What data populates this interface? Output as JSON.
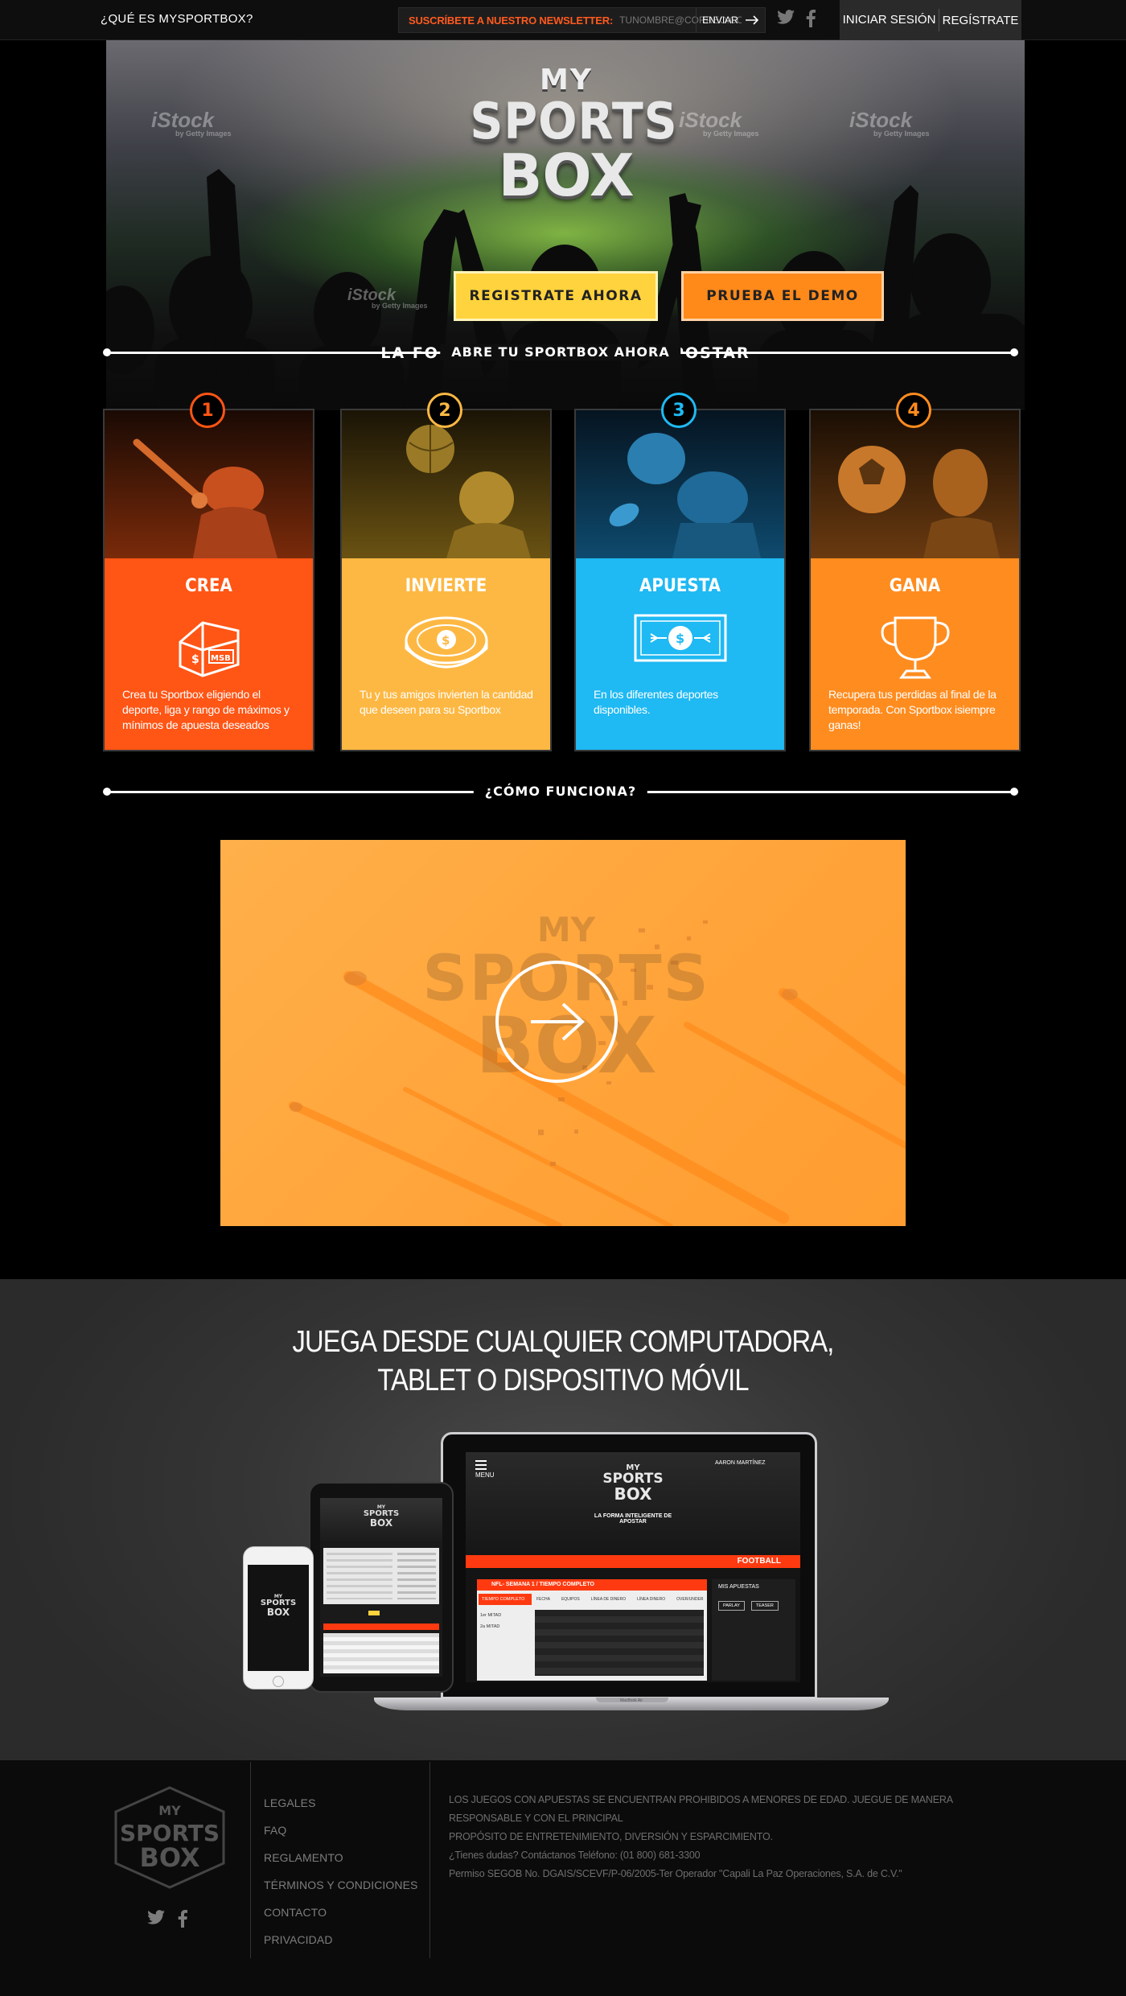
{
  "topbar": {
    "about_link": "¿QUÉ ES MYSPORTBOX?",
    "newsletter_label": "SUSCRÍBETE A NUESTRO NEWSLETTER:",
    "newsletter_placeholder": "TUNOMBRE@CORREO.COM",
    "send_label": "ENVIAR",
    "login_label": "INICIAR SESIÓN",
    "register_label": "REGÍSTRATE",
    "icons": [
      "twitter-icon",
      "facebook-icon",
      "arrow-right-icon"
    ]
  },
  "hero": {
    "logo": {
      "my": "MY",
      "sports": "SPORTS",
      "box": "BOX"
    },
    "watermarks": [
      "iStock",
      "iStock",
      "iStock",
      "iStock"
    ],
    "watermark_sub": "by Getty Images",
    "register_button": "REGISTRATE AHORA",
    "demo_button": "PRUEBA EL DEMO",
    "tagline": "LA FORMA INTELIGENTE DE APOSTAR"
  },
  "section_open": {
    "label": "ABRE TU SPORTBOX AHORA"
  },
  "steps": [
    {
      "number": "1",
      "title": "CREA",
      "description": "Crea tu Sportbox eligiendo el deporte, liga y rango de máximos y mínimos de apuesta deseados",
      "color": "#ff5515"
    },
    {
      "number": "2",
      "title": "INVIERTE",
      "description": "Tu y tus amigos invierten la cantidad que deseen para su Sportbox",
      "color": "#fdb843"
    },
    {
      "number": "3",
      "title": "APUESTA",
      "description": "En los diferentes deportes disponibles.",
      "color": "#1fb9f3"
    },
    {
      "number": "4",
      "title": "GANA",
      "description": "Recupera tus perdidas al final de la temporada. Con Sportbox isiempre ganas!",
      "color": "#ff8c1f"
    }
  ],
  "icon_labels": {
    "house": "MSB",
    "coin": "$",
    "bill": "$"
  },
  "section_how": {
    "label": "¿CÓMO FUNCIONA?"
  },
  "video": {
    "logo": {
      "my": "MY",
      "sports": "SPORTS",
      "box": "BOX"
    }
  },
  "devices": {
    "title_line1": "JUEGA DESDE CUALQUIER COMPUTADORA,",
    "title_line2": "TABLET O DISPOSITIVO MÓVIL",
    "laptop": {
      "menu": "MENU",
      "user": "AARON MARTÍNEZ",
      "logo": {
        "my": "MY",
        "sports": "SPORTS",
        "box": "BOX"
      },
      "tagline": "LA FORMA INTELIGENTE DE APOSTAR",
      "sport_bar": "FOOTBALL",
      "panel_title": "NFL- SEMANA 1 / TIEMPO COMPLETO",
      "tab_active": "TIEMPO COMPLETO",
      "side_items": [
        "1er MITAD",
        "2a MITAD"
      ],
      "columns": [
        "FECHA",
        "EQUIPOS",
        "LÍNEA DE DINERO",
        "LÍNEA DINERO",
        "OVER/UNDER"
      ],
      "bets_title": "MIS APUESTAS",
      "bets_buttons": [
        "PARLAY",
        "TEASER"
      ],
      "brand": "MacBook Air"
    },
    "tablet": {
      "logo": {
        "my": "MY",
        "sports": "SPORTS",
        "box": "BOX"
      }
    },
    "phone": {
      "logo": {
        "my": "MY",
        "sports": "SPORTS",
        "box": "BOX"
      }
    }
  },
  "footer": {
    "logo": {
      "my": "MY",
      "sports": "SPORTS",
      "box": "BOX"
    },
    "links": [
      "LEGALES",
      "FAQ",
      "REGLAMENTO",
      "TÉRMINOS Y CONDICIONES",
      "CONTACTO",
      "PRIVACIDAD"
    ],
    "text_lines": [
      "LOS JUEGOS CON APUESTAS SE ENCUENTRAN PROHIBIDOS A MENORES DE EDAD. JUEGUE DE MANERA RESPONSABLE Y CON EL PRINCIPAL",
      "PROPÓSITO DE ENTRETENIMIENTO, DIVERSIÓN Y ESPARCIMIENTO.",
      "¿Tienes dudas? Contáctanos Teléfono: (01 800) 681-3300",
      "Permiso SEGOB No. DGAIS/SCEVF/P-06/2005-Ter Operador \"Capali La Paz Operaciones, S.A. de C.V.\""
    ]
  },
  "colors": {
    "accent_orange": "#ff5a1f",
    "yellow": "#ffd33d",
    "orange_button": "#ff8a1a",
    "step1": "#ff5515",
    "step2": "#fdb843",
    "step3": "#1fb9f3",
    "step4": "#ff8c1f"
  }
}
